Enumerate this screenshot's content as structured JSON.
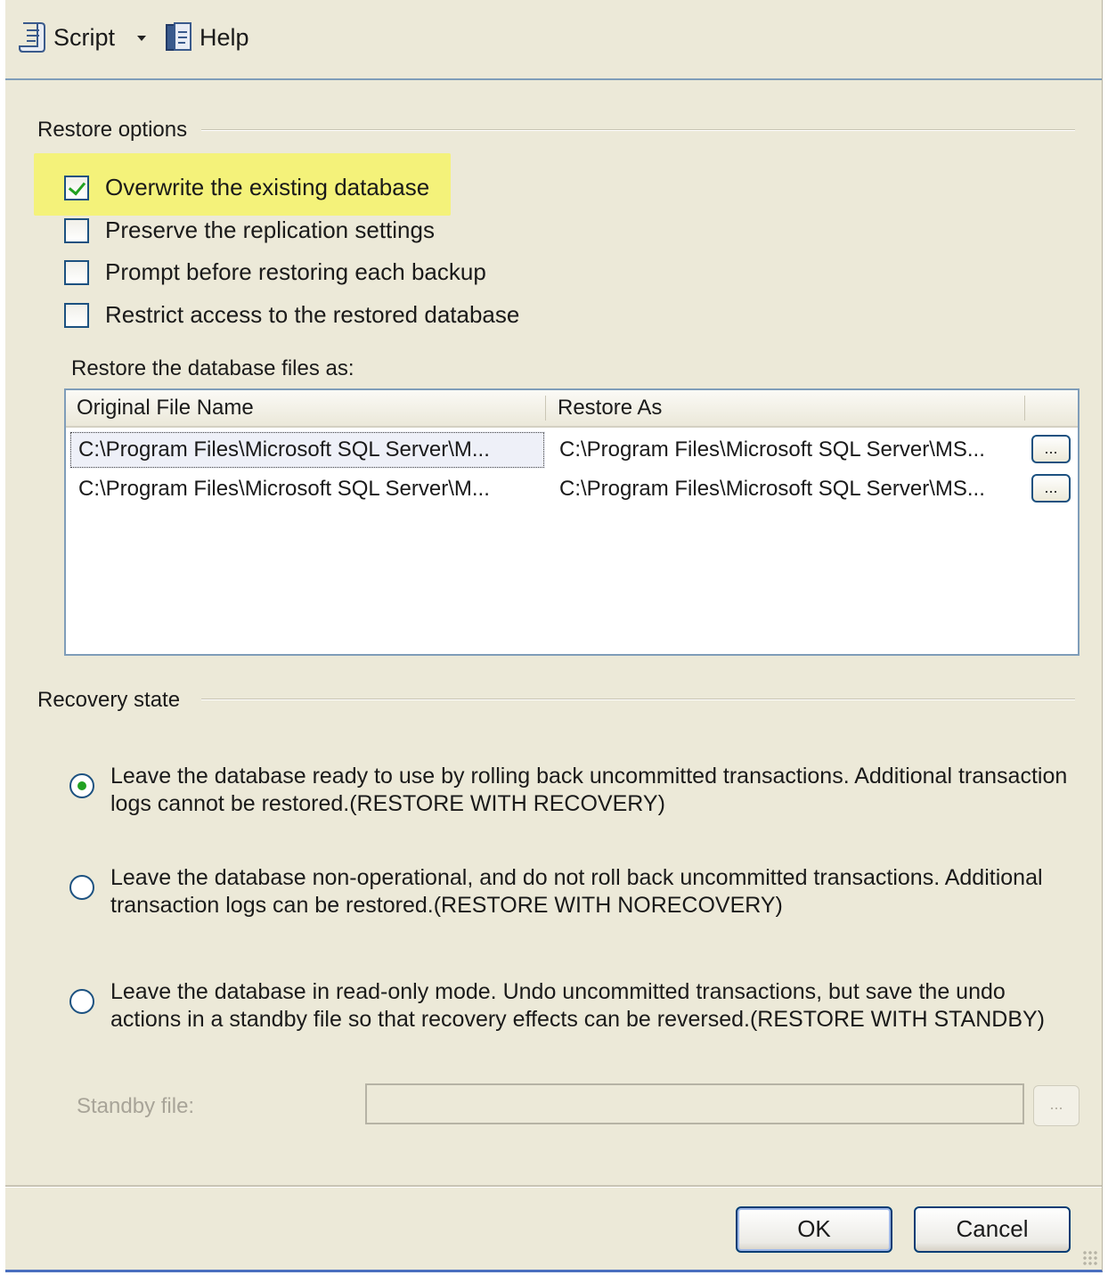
{
  "toolbar": {
    "script_label": "Script",
    "help_label": "Help"
  },
  "restore_options": {
    "title": "Restore options",
    "checkboxes": [
      {
        "label": "Overwrite the existing database",
        "checked": true
      },
      {
        "label": "Preserve the replication settings",
        "checked": false
      },
      {
        "label": "Prompt before restoring each backup",
        "checked": false
      },
      {
        "label": "Restrict access to the restored database",
        "checked": false
      }
    ],
    "files_label": "Restore the database files as:",
    "grid": {
      "columns": [
        "Original File Name",
        "Restore As"
      ],
      "rows": [
        {
          "original": "C:\\Program Files\\Microsoft SQL Server\\M...",
          "restore_as": "C:\\Program Files\\Microsoft SQL Server\\MS...",
          "button": "..."
        },
        {
          "original": "C:\\Program Files\\Microsoft SQL Server\\M...",
          "restore_as": "C:\\Program Files\\Microsoft SQL Server\\MS...",
          "button": "..."
        }
      ]
    }
  },
  "recovery_state": {
    "title": "Recovery state",
    "options": [
      {
        "text": "Leave the database ready to use by rolling back uncommitted transactions. Additional transaction logs cannot be restored.(RESTORE WITH RECOVERY)",
        "selected": true
      },
      {
        "text": "Leave the database non-operational, and do not roll back uncommitted transactions. Additional transaction logs can be restored.(RESTORE WITH NORECOVERY)",
        "selected": false
      },
      {
        "text": "Leave the database in read-only mode. Undo uncommitted transactions, but save the undo actions in a standby file so that recovery effects can be reversed.(RESTORE WITH STANDBY)",
        "selected": false
      }
    ],
    "standby_label": "Standby file:",
    "standby_value": "",
    "standby_button": "..."
  },
  "footer": {
    "ok_label": "OK",
    "cancel_label": "Cancel"
  },
  "colors": {
    "dialog_bg": "#ece9d8",
    "highlight": "#f4f27a",
    "accent_border": "#1c5180",
    "check_green": "#21a121"
  }
}
